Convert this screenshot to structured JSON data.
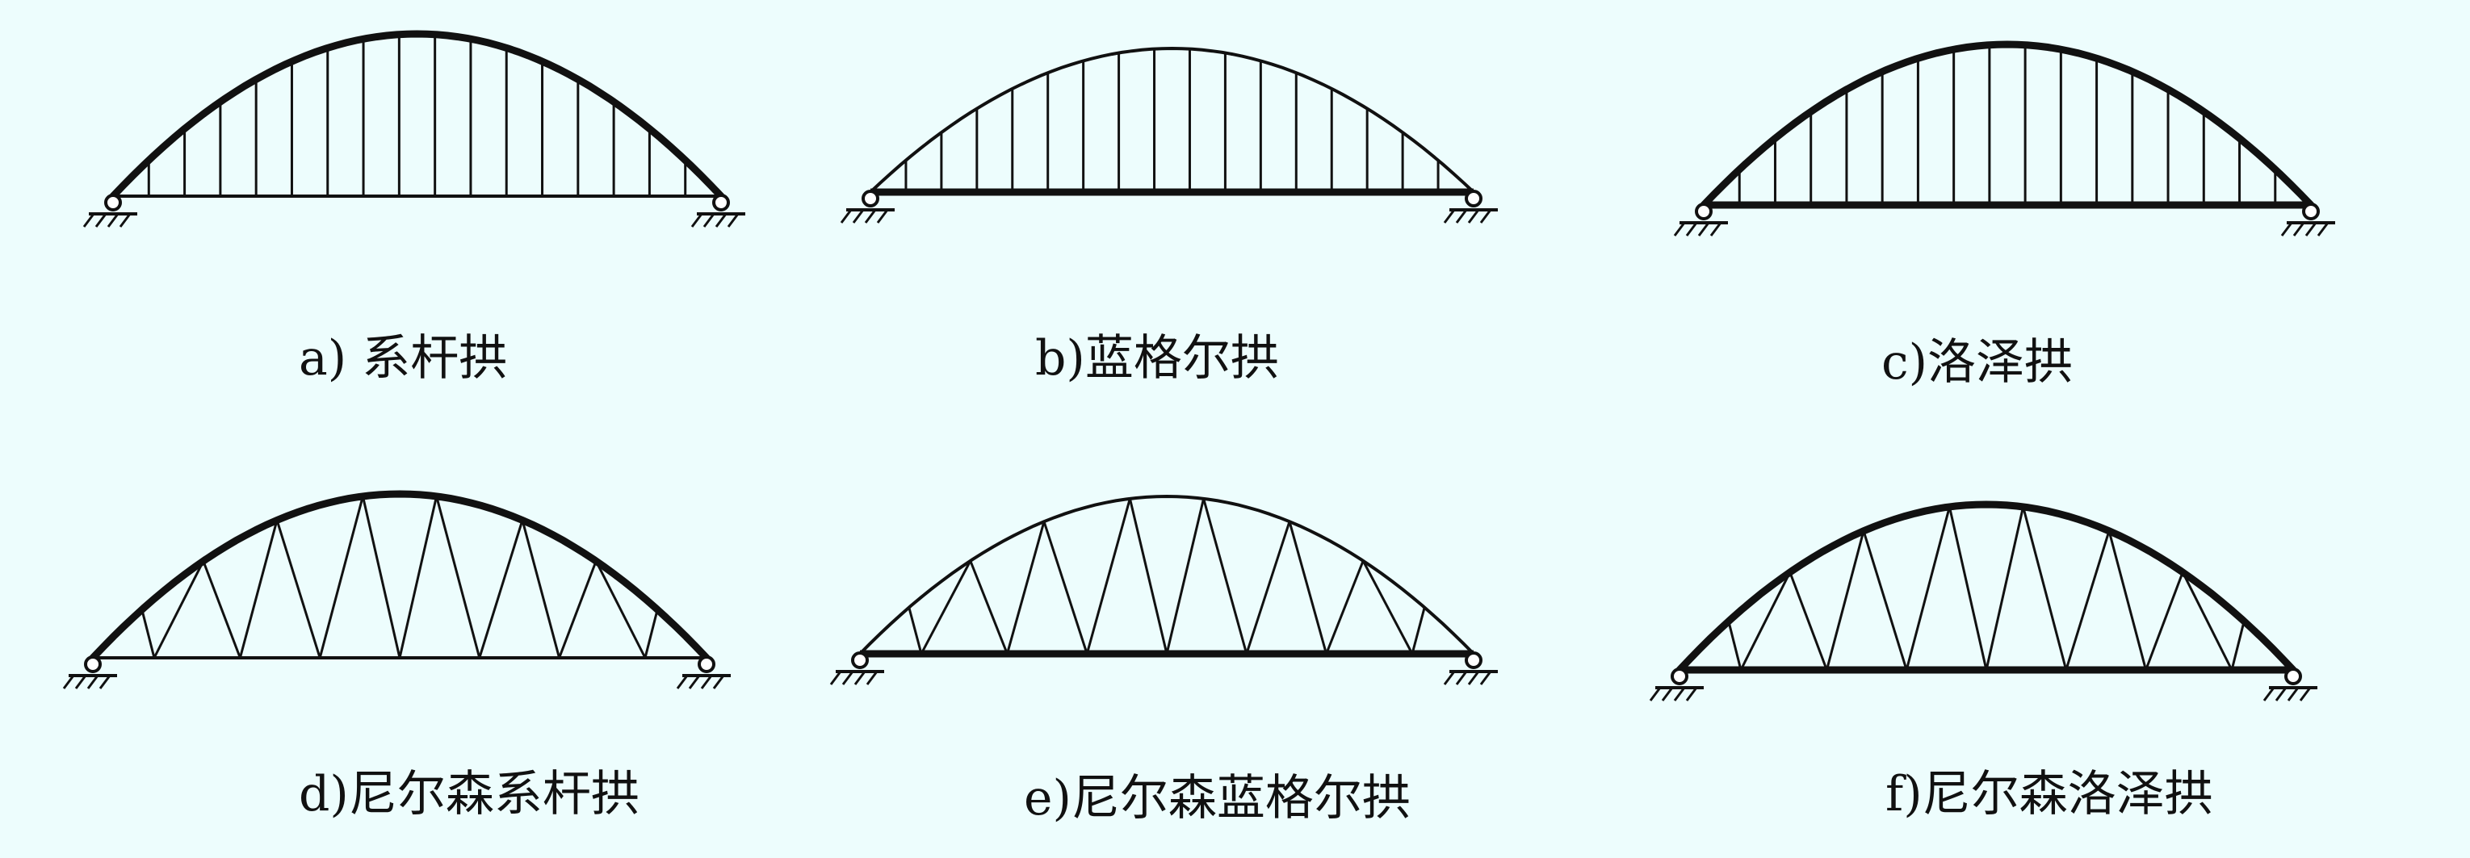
{
  "colors": {
    "background": "#edfdfd",
    "stroke": "#111111"
  },
  "figures": [
    {
      "id": "a",
      "caption": "a) 系杆拱",
      "arch": "thick",
      "tie": "thin",
      "web": "vertical"
    },
    {
      "id": "b",
      "caption": "b)蓝格尔拱",
      "arch": "thin",
      "tie": "thick",
      "web": "vertical"
    },
    {
      "id": "c",
      "caption": "c)洛泽拱",
      "arch": "thick",
      "tie": "thick",
      "web": "vertical"
    },
    {
      "id": "d",
      "caption": "d)尼尔森系杆拱",
      "arch": "thick",
      "tie": "thin",
      "web": "nielsen"
    },
    {
      "id": "e",
      "caption": "e)尼尔森蓝格尔拱",
      "arch": "thin",
      "tie": "thick",
      "web": "nielsen"
    },
    {
      "id": "f",
      "caption": "f)尼尔森洛泽拱",
      "arch": "thick",
      "tie": "thick",
      "web": "nielsen"
    }
  ]
}
